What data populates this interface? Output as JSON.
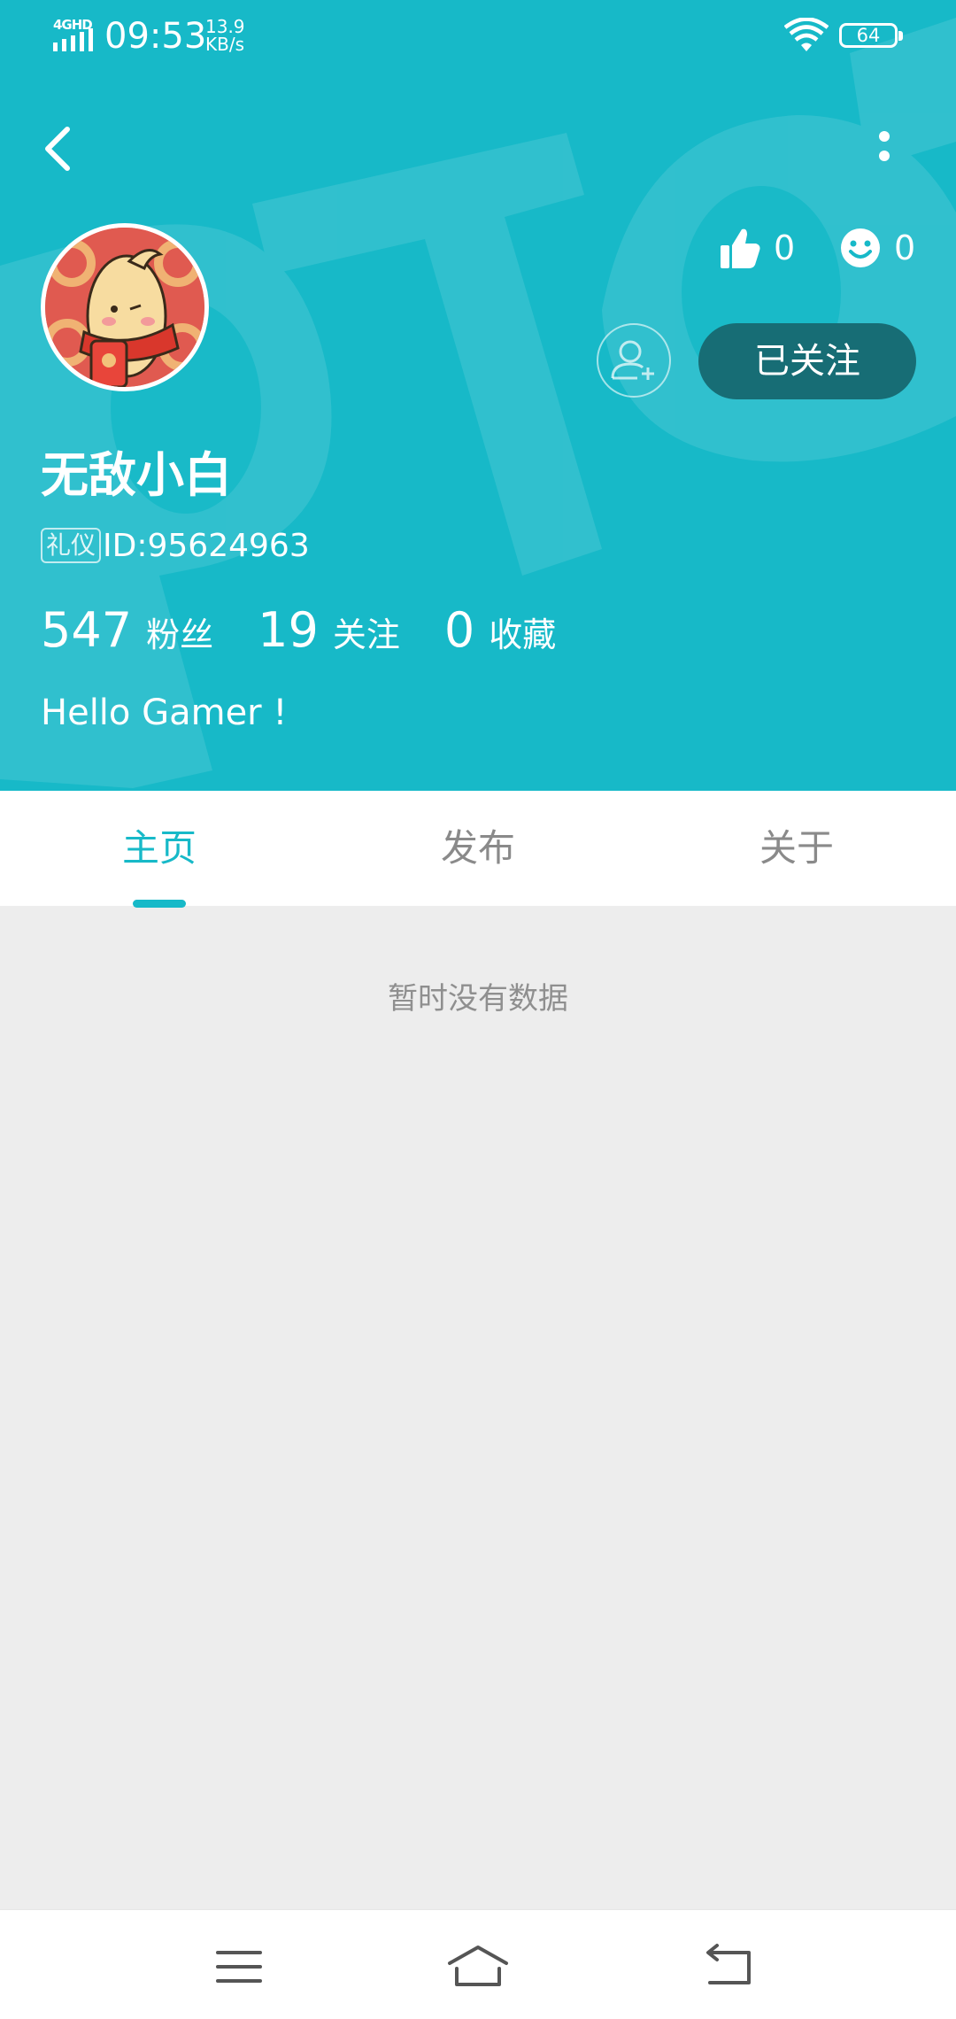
{
  "status_bar": {
    "network": "4GHD",
    "time": "09:53",
    "speed_value": "13.9",
    "speed_unit": "KB/s",
    "battery": "64"
  },
  "nav": {
    "back_icon": "chevron-left-icon",
    "more_icon": "more-vertical-icon"
  },
  "profile": {
    "likes_count": "0",
    "smiles_count": "0",
    "follow_label": "已关注",
    "username": "无敌小白",
    "badge": "礼仪",
    "user_id": "ID:95624963",
    "fans_count": "547",
    "fans_label": "粉丝",
    "following_count": "19",
    "following_label": "关注",
    "favorites_count": "0",
    "favorites_label": "收藏",
    "bio": "Hello Gamer !"
  },
  "tabs": [
    {
      "label": "主页",
      "active": true
    },
    {
      "label": "发布",
      "active": false
    },
    {
      "label": "关于",
      "active": false
    }
  ],
  "content": {
    "empty_text": "暂时没有数据"
  },
  "colors": {
    "accent": "#17b9c8",
    "follow_button": "#176d75",
    "background": "#ededed"
  }
}
